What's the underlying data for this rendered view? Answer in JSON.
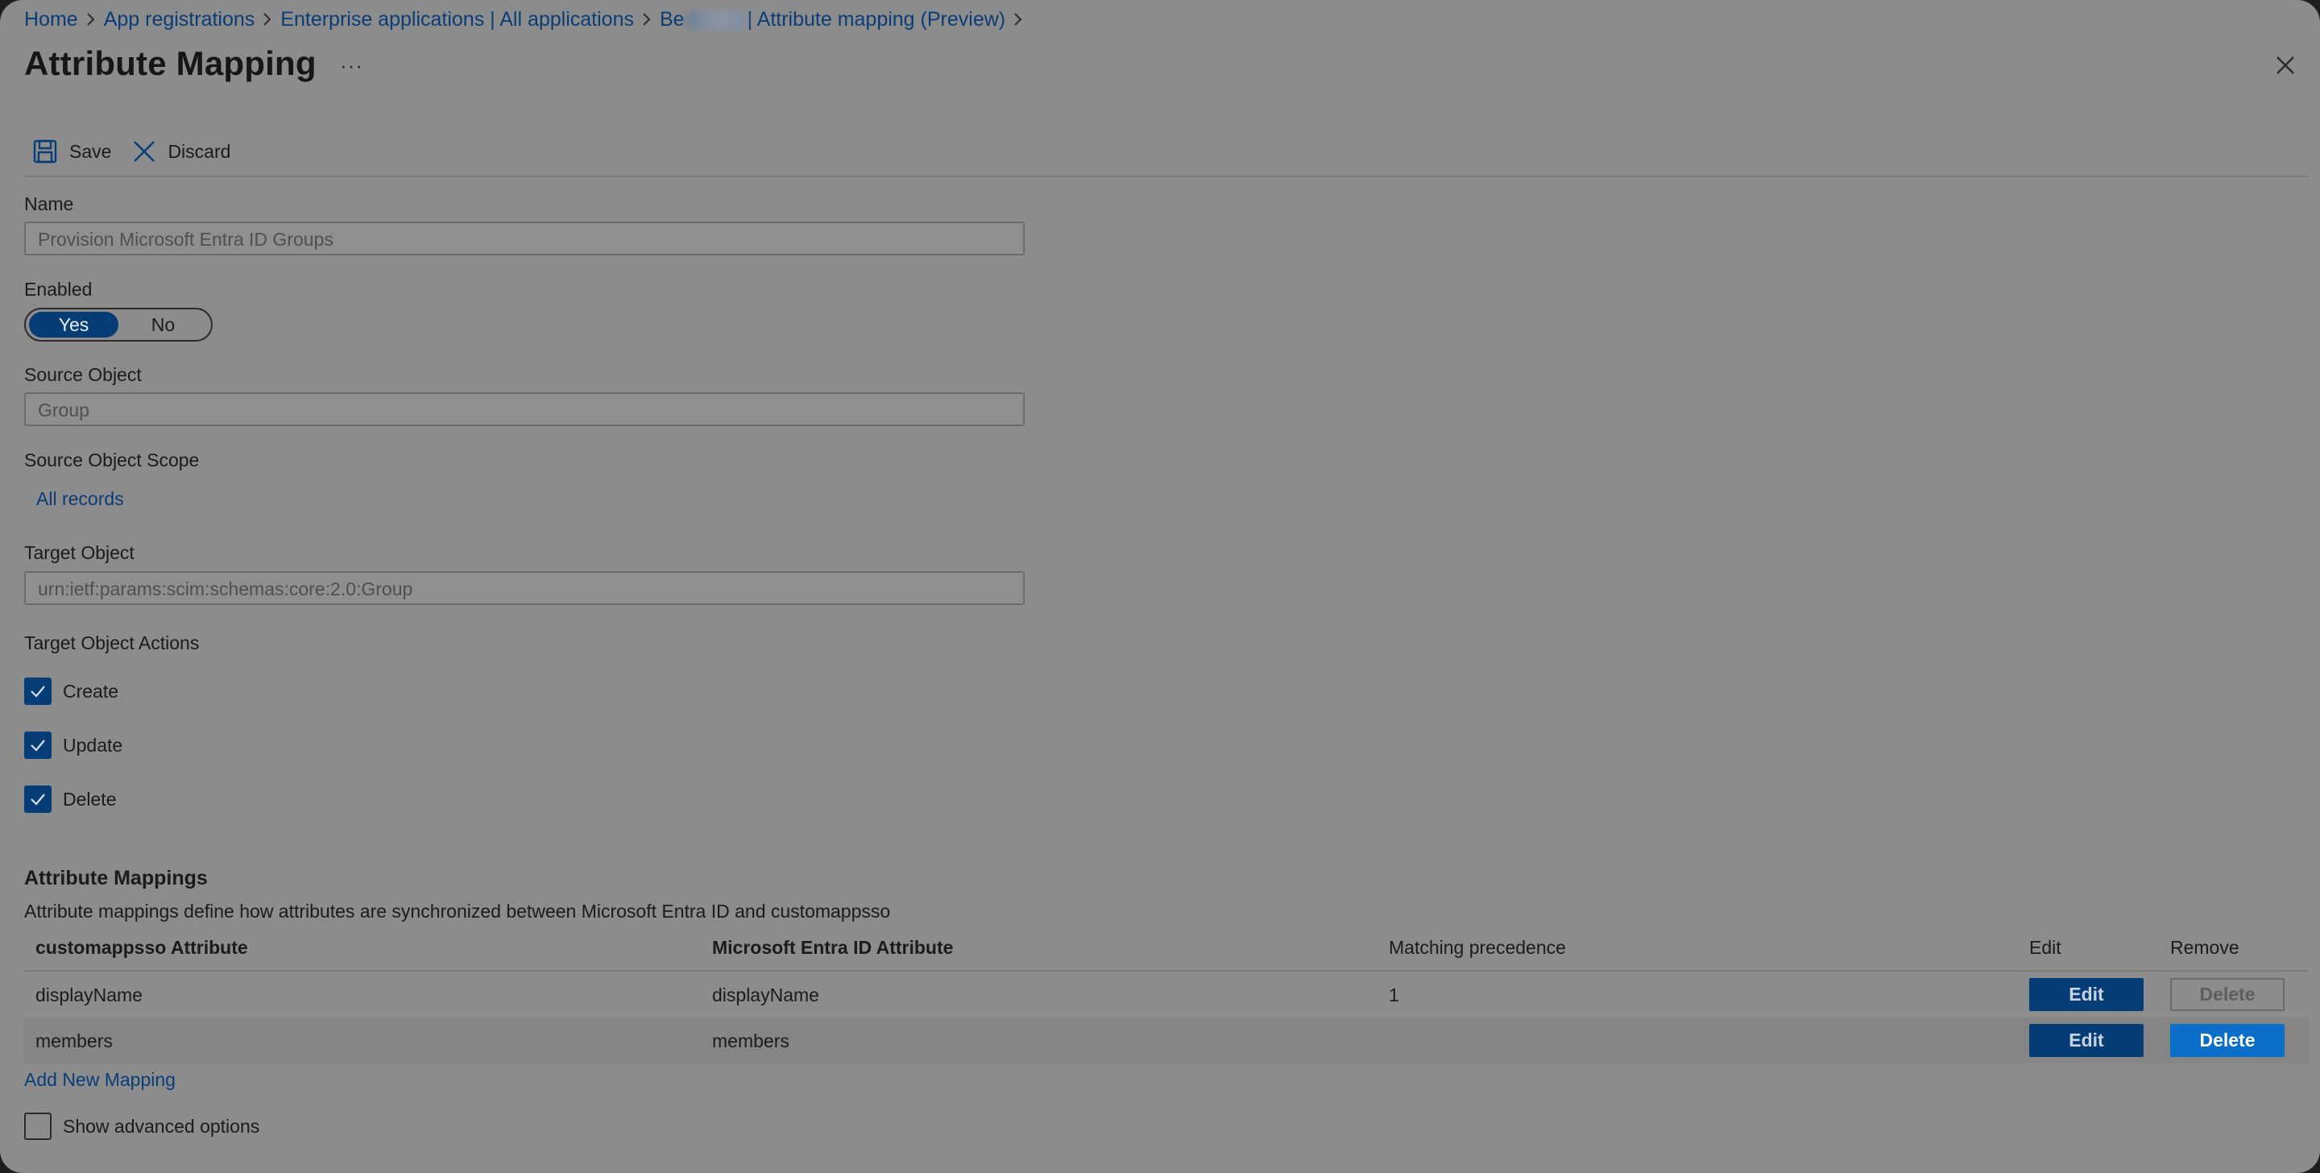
{
  "breadcrumb": {
    "items": [
      "Home",
      "App registrations",
      "Enterprise applications | All applications"
    ],
    "last_prefix": "Be",
    "last_suffix": "| Attribute mapping (Preview)"
  },
  "page": {
    "title": "Attribute Mapping",
    "more": "···"
  },
  "toolbar": {
    "save_label": "Save",
    "discard_label": "Discard"
  },
  "form": {
    "name_label": "Name",
    "name_value": "Provision Microsoft Entra ID Groups",
    "enabled_label": "Enabled",
    "enabled_yes": "Yes",
    "enabled_no": "No",
    "enabled_value": "Yes",
    "source_object_label": "Source Object",
    "source_object_value": "Group",
    "source_scope_label": "Source Object Scope",
    "source_scope_link": "All records",
    "target_object_label": "Target Object",
    "target_object_value": "urn:ietf:params:scim:schemas:core:2.0:Group",
    "target_actions_label": "Target Object Actions",
    "actions": [
      {
        "label": "Create",
        "checked": true
      },
      {
        "label": "Update",
        "checked": true
      },
      {
        "label": "Delete",
        "checked": true
      }
    ]
  },
  "mappings": {
    "title": "Attribute Mappings",
    "description": "Attribute mappings define how attributes are synchronized between Microsoft Entra ID and customappsso",
    "columns": [
      "customappsso Attribute",
      "Microsoft Entra ID Attribute",
      "Matching precedence",
      "Edit",
      "Remove"
    ],
    "rows": [
      {
        "target": "displayName",
        "source": "displayName",
        "precedence": "1",
        "edit": "Edit",
        "remove": "Delete",
        "remove_enabled": false
      },
      {
        "target": "members",
        "source": "members",
        "precedence": "",
        "edit": "Edit",
        "remove": "Delete",
        "remove_enabled": true
      }
    ],
    "add_link": "Add New Mapping",
    "advanced_label": "Show advanced options",
    "advanced_checked": false
  },
  "colors": {
    "accent": "#063d76",
    "link": "#0a3d78",
    "delete_active": "#0b6fc9",
    "overlay_bg": "#8c8c8c"
  }
}
